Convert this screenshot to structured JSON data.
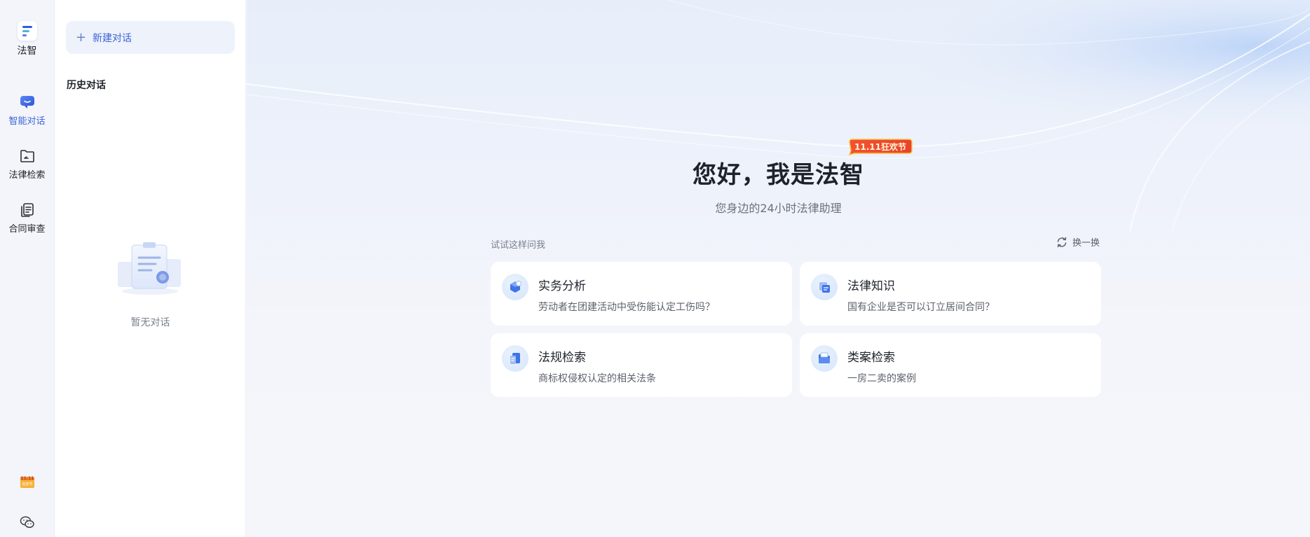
{
  "app": {
    "name": "法智"
  },
  "rail": {
    "items": [
      {
        "label": "智能对话",
        "active": true,
        "icon": "chat-bubble-icon"
      },
      {
        "label": "法律检索",
        "active": false,
        "icon": "folder-search-icon"
      },
      {
        "label": "合同审查",
        "active": false,
        "icon": "contract-review-icon"
      }
    ],
    "promo_badge": {
      "top": "11.11",
      "bottom": "狂欢节"
    }
  },
  "panel": {
    "new_chat_label": "新建对话",
    "history_title": "历史对话",
    "empty_text": "暂无对话"
  },
  "main": {
    "promo_tag": "11.11狂欢节",
    "greeting": "您好，我是法智",
    "subtitle": "您身边的24小时法律助理",
    "try_label": "试试这样问我",
    "refresh_label": "换一换",
    "cards": [
      {
        "title": "实务分析",
        "desc": "劳动者在团建活动中受伤能认定工伤吗？",
        "icon": "practice-analysis-icon"
      },
      {
        "title": "法律知识",
        "desc": "国有企业是否可以订立居间合同？",
        "icon": "legal-knowledge-icon"
      },
      {
        "title": "法规检索",
        "desc": "商标权侵权认定的相关法条",
        "icon": "regulation-search-icon"
      },
      {
        "title": "类案检索",
        "desc": "一房二卖的案例",
        "icon": "case-search-icon"
      }
    ]
  },
  "colors": {
    "accent": "#3d63d8",
    "promo": "#e8432a"
  }
}
